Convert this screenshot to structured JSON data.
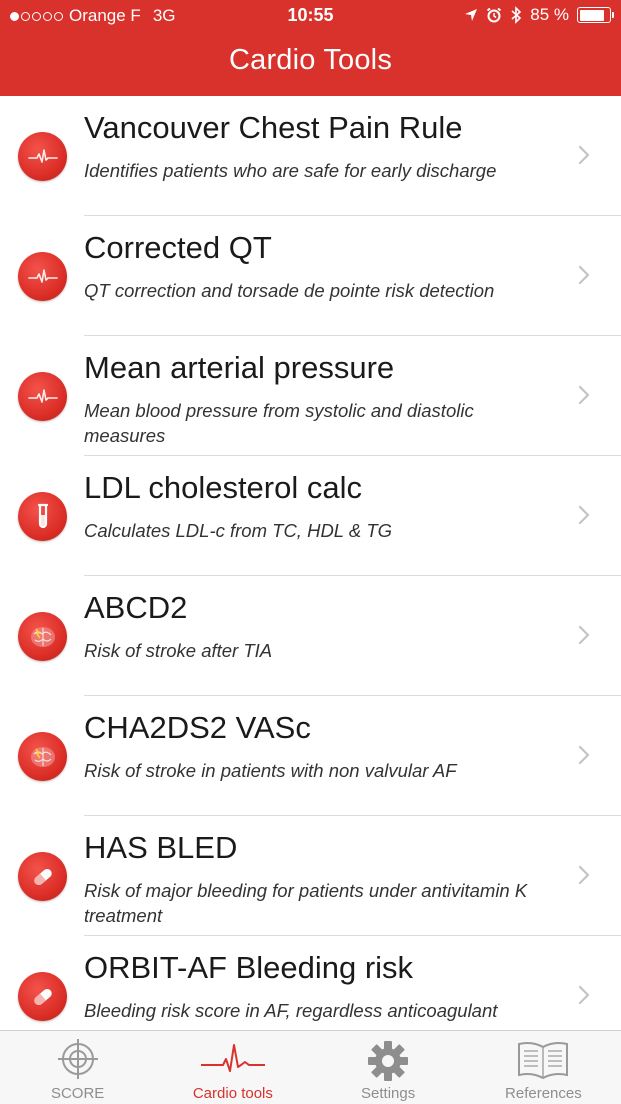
{
  "status_bar": {
    "carrier": "Orange F",
    "network": "3G",
    "time": "10:55",
    "battery": "85 %",
    "battery_level": 0.85
  },
  "nav": {
    "title": "Cardio Tools"
  },
  "items": [
    {
      "title": "Vancouver Chest Pain Rule",
      "subtitle": "Identifies patients who are safe for early discharge",
      "icon": "heartbeat-icon"
    },
    {
      "title": "Corrected QT",
      "subtitle": "QT correction and torsade de pointe risk detection",
      "icon": "heartbeat-icon"
    },
    {
      "title": "Mean arterial pressure",
      "subtitle": "Mean blood pressure from systolic and diastolic measures",
      "icon": "heartbeat-icon"
    },
    {
      "title": "LDL cholesterol calc",
      "subtitle": "Calculates LDL-c from TC, HDL & TG",
      "icon": "test-tube-icon"
    },
    {
      "title": "ABCD2",
      "subtitle": "Risk of stroke after TIA",
      "icon": "brain-icon"
    },
    {
      "title": "CHA2DS2 VASc",
      "subtitle": "Risk of stroke in patients with non valvular AF",
      "icon": "brain-icon"
    },
    {
      "title": "HAS BLED",
      "subtitle": "Risk of major bleeding for patients under antivitamin K treatment",
      "icon": "pill-icon"
    },
    {
      "title": "ORBIT-AF Bleeding risk",
      "subtitle": "Bleeding risk score in AF, regardless anticoagulant",
      "icon": "pill-icon"
    }
  ],
  "tabs": [
    {
      "label": "SCORE",
      "icon": "crosshair-icon"
    },
    {
      "label": "Cardio tools",
      "icon": "heartbeat-icon"
    },
    {
      "label": "Settings",
      "icon": "gear-icon"
    },
    {
      "label": "References",
      "icon": "book-icon"
    }
  ],
  "colors": {
    "accent": "#d9312b",
    "tab_inactive": "#8e8e8e"
  }
}
